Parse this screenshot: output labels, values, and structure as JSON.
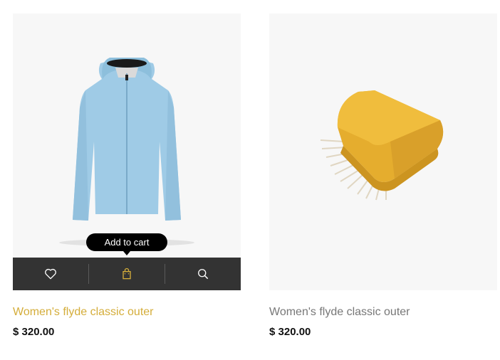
{
  "colors": {
    "accent": "#d4ad3a",
    "bar": "#333333",
    "placeholder_bg": "#f7f7f7"
  },
  "products": [
    {
      "title": "Women's flyde classic outer",
      "price": "$ 320.00",
      "tooltip": "Add to cart",
      "actions": [
        "heart-icon",
        "shopping-bag-icon",
        "search-icon"
      ]
    },
    {
      "title": "Women's flyde classic outer",
      "price": "$ 320.00"
    }
  ]
}
